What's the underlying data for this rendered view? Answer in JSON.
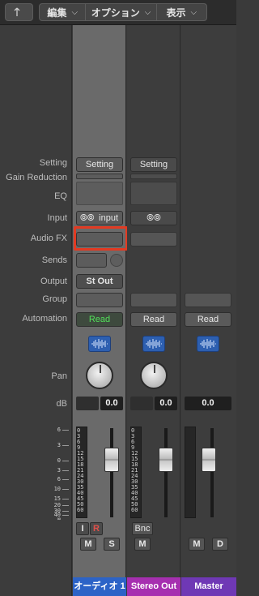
{
  "toolbar": {
    "back_icon": "back-arrow-icon",
    "menus": [
      {
        "label": "編集"
      },
      {
        "label": "オプション"
      },
      {
        "label": "表示"
      }
    ],
    "chevron": "⌵"
  },
  "row_labels": {
    "setting": "Setting",
    "gain_reduction": "Gain Reduction",
    "eq": "EQ",
    "input": "Input",
    "audio_fx": "Audio FX",
    "sends": "Sends",
    "output": "Output",
    "group": "Group",
    "automation": "Automation",
    "pan": "Pan",
    "db": "dB"
  },
  "scale_labels": [
    "6",
    "3",
    "0",
    "3",
    "6",
    "10",
    "15",
    "20",
    "30",
    "40",
    "∞"
  ],
  "meter_scale": [
    "0",
    "3",
    "6",
    "9",
    "12",
    "15",
    "18",
    "21",
    "24",
    "30",
    "35",
    "40",
    "45",
    "50",
    "60"
  ],
  "channels": [
    {
      "name": "オーディオ 1",
      "color": "#2c63c7",
      "setting": "Setting",
      "input": "input",
      "output": "St Out",
      "automation": "Read",
      "automation_color": "#52e05a",
      "db": "0.0",
      "input_monitor": "I",
      "record": "R",
      "record_color": "#e0504a",
      "mute": "M",
      "solo": "S"
    },
    {
      "name": "Stereo Out",
      "color": "#a62fb0",
      "setting": "Setting",
      "automation": "Read",
      "db": "0.0",
      "bounce": "Bnc",
      "mute": "M"
    },
    {
      "name": "Master",
      "color": "#6f38b5",
      "automation": "Read",
      "db": "0.0",
      "mute": "M",
      "dim": "D"
    }
  ]
}
